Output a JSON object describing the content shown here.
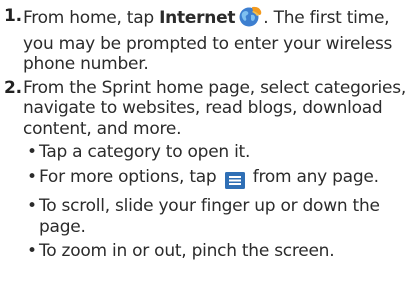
{
  "steps": [
    {
      "number": "1.",
      "pre": "From home, tap ",
      "bold": "Internet",
      "icon": "globe-icon",
      "post": ". The first time, you may be prompted to enter your wireless phone number."
    },
    {
      "number": "2.",
      "text": "From the Sprint home page, select categories, navigate to websites, read blogs, download content, and more.",
      "bullets": [
        {
          "text": "Tap a category to open it."
        },
        {
          "pre": "For more options, tap ",
          "icon": "menu-icon",
          "post": " from any page."
        },
        {
          "text": "To scroll, slide your finger up or down the page."
        },
        {
          "text": "To zoom in or out, pinch the screen."
        }
      ]
    }
  ],
  "colors": {
    "text": "#2b2b2b",
    "menu_icon": "#2f6fb5",
    "globe_blue": "#3d7fd0",
    "globe_orange": "#f39a1e"
  }
}
